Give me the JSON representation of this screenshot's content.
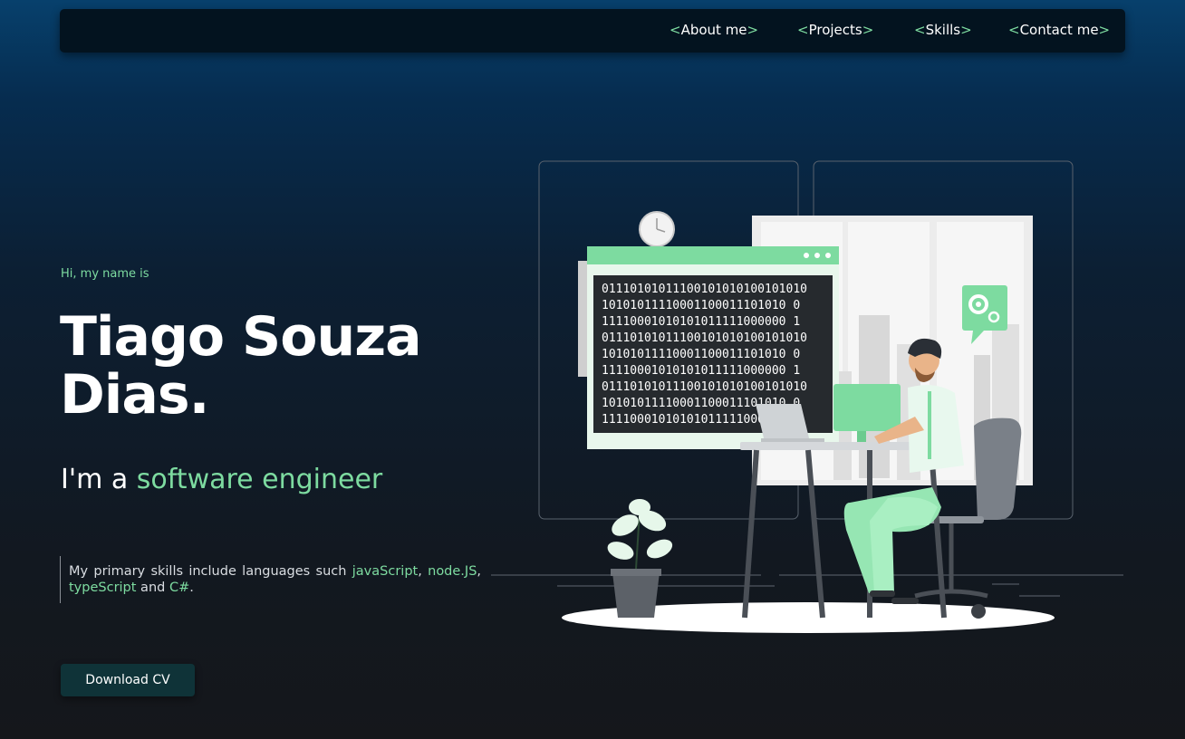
{
  "nav": {
    "items": [
      {
        "label": "About me"
      },
      {
        "label": "Projects"
      },
      {
        "label": "Skills"
      },
      {
        "label": "Contact me"
      }
    ],
    "open_bracket": "<",
    "close_bracket": ">"
  },
  "hero": {
    "greeting": "Hi, my name is",
    "name": "Tiago Souza Dias.",
    "role_prefix": "I'm a ",
    "role_highlight": "software engineer",
    "skills": {
      "intro": "My primary skills include languages such ",
      "lang1": "javaScript",
      "sep1": ", ",
      "lang2": "node.JS",
      "sep2": ", ",
      "lang3": "typeScript",
      "sep3": " and ",
      "lang4": "C#",
      "end": "."
    },
    "download_label": "Download CV"
  },
  "illustration": {
    "binary_lines": [
      "01110101011100101010100101010",
      "10101011110001100011101010 0",
      "11110001010101011111000000 1",
      "01110101011100101010100101010",
      "10101011110001100011101010 0",
      "11110001010101011111000000 1",
      "01110101011100101010100101010",
      "10101011110001100011101010 0",
      "11110001010101011111000000 1"
    ]
  },
  "colors": {
    "accent": "#7ddba0",
    "nav_bg": "#03131f",
    "button_bg": "#0f3338"
  }
}
